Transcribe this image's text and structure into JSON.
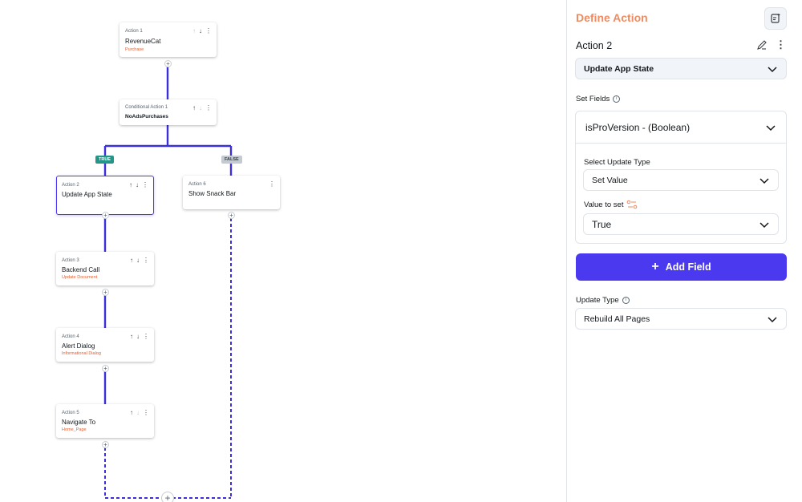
{
  "flow": {
    "action1": {
      "title": "Action 1",
      "name": "RevenueCat",
      "sub": "Purchase"
    },
    "conditional": {
      "title": "Conditional Action 1",
      "name": "NoAdsPurchases"
    },
    "badge_true": "TRUE",
    "badge_false": "FALSE",
    "action2": {
      "title": "Action 2",
      "name": "Update App State"
    },
    "action6": {
      "title": "Action 6",
      "name": "Show Snack Bar"
    },
    "action3": {
      "title": "Action 3",
      "name": "Backend Call",
      "sub": "Update Document"
    },
    "action4": {
      "title": "Action 4",
      "name": "Alert Dialog",
      "sub": "Informational Dialog"
    },
    "action5": {
      "title": "Action 5",
      "name": "Navigate To",
      "sub": "Home_Page"
    },
    "plus": "+"
  },
  "panel": {
    "title": "Define Action",
    "action_label": "Action 2",
    "action_type": "Update App State",
    "set_fields_label": "Set Fields",
    "field": {
      "name": "isProVersion - (Boolean)",
      "update_type_label": "Select Update Type",
      "update_type_value": "Set Value",
      "value_label": "Value to set",
      "value": "True"
    },
    "add_field_label": "Add Field",
    "update_type_label": "Update Type",
    "update_type_value": "Rebuild All Pages"
  },
  "colors": {
    "accent": "#4b39ef",
    "title": "#ee8b60",
    "true_badge": "#249689",
    "subtitle": "#e65c2b"
  }
}
